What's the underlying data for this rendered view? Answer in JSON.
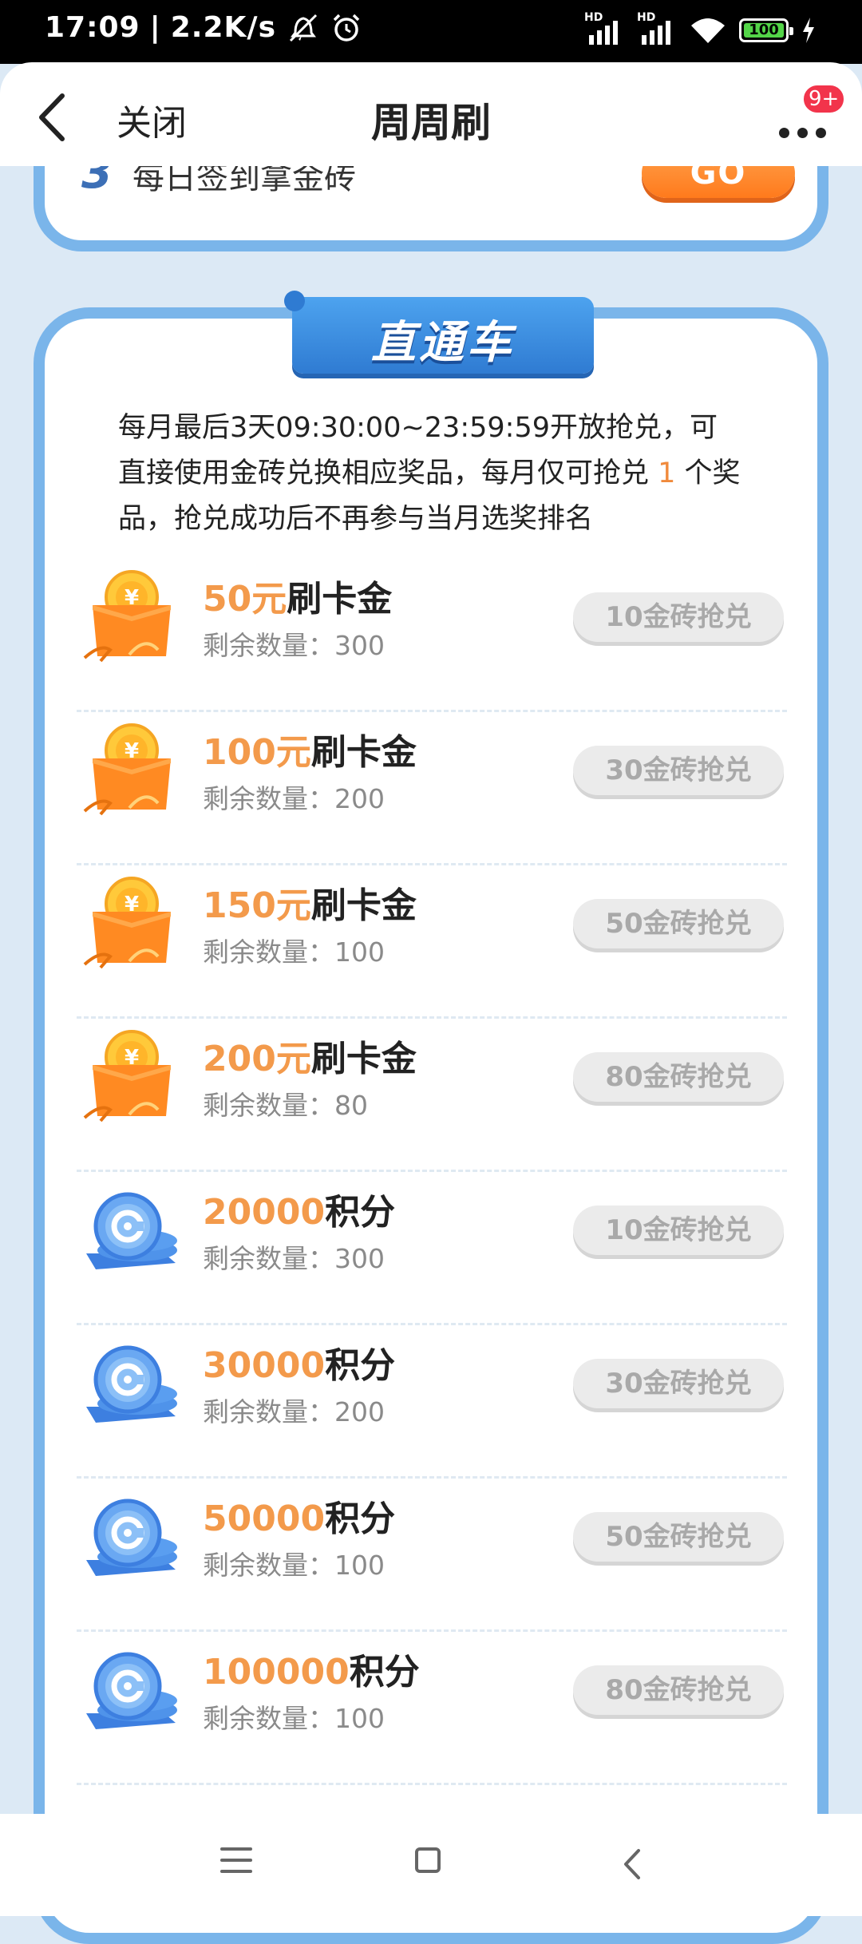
{
  "status_bar": {
    "time": "17:09",
    "speed": "2.2K/s",
    "signal1_label": "HD",
    "signal2_label": "HD",
    "battery": "100"
  },
  "header": {
    "close_label": "关闭",
    "title": "周周刷",
    "badge": "9+"
  },
  "task": {
    "number": "3",
    "text": "每日签到拿金砖",
    "button": "GO"
  },
  "express": {
    "title": "直通车",
    "rules_part1": "每月最后3天09:30:00~23:59:59开放抢兑，可直接使用金砖兑换相应奖品，每月仅可抢兑 ",
    "rules_highlight": "1",
    "rules_part2": " 个奖品，抢兑成功后不再参与当月选奖排名",
    "prizes": [
      {
        "amount": "50元",
        "unit": "刷卡金",
        "stock": "剩余数量：300",
        "button": "10金砖抢兑",
        "icon": "gift-box-coin-icon"
      },
      {
        "amount": "100元",
        "unit": "刷卡金",
        "stock": "剩余数量：200",
        "button": "30金砖抢兑",
        "icon": "gift-box-coin-icon"
      },
      {
        "amount": "150元",
        "unit": "刷卡金",
        "stock": "剩余数量：100",
        "button": "50金砖抢兑",
        "icon": "gift-box-coin-icon"
      },
      {
        "amount": "200元",
        "unit": "刷卡金",
        "stock": "剩余数量：80",
        "button": "80金砖抢兑",
        "icon": "gift-box-coin-icon"
      },
      {
        "amount": "20000",
        "unit": "积分",
        "stock": "剩余数量：300",
        "button": "10金砖抢兑",
        "icon": "points-coin-stack-icon"
      },
      {
        "amount": "30000",
        "unit": "积分",
        "stock": "剩余数量：200",
        "button": "30金砖抢兑",
        "icon": "points-coin-stack-icon"
      },
      {
        "amount": "50000",
        "unit": "积分",
        "stock": "剩余数量：100",
        "button": "50金砖抢兑",
        "icon": "points-coin-stack-icon"
      },
      {
        "amount": "100000",
        "unit": "积分",
        "stock": "剩余数量：100",
        "button": "80金砖抢兑",
        "icon": "points-coin-stack-icon"
      }
    ]
  },
  "colors": {
    "accent_orange": "#f39a4b",
    "card_border": "#7ab5ea",
    "title_blue": "#2f7bd2",
    "page_bg": "#dce9f5"
  }
}
